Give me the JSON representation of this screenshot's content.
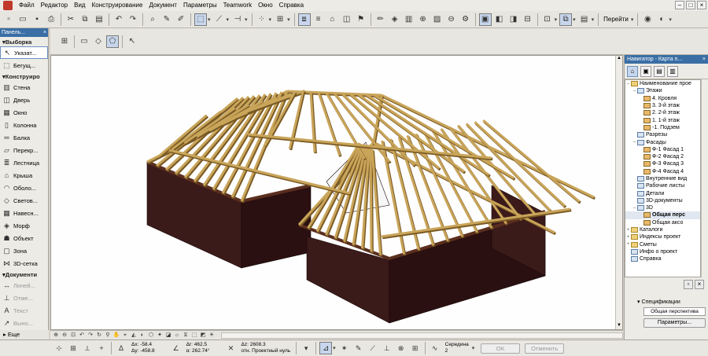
{
  "menu": {
    "items": [
      "Файл",
      "Редактор",
      "Вид",
      "Конструирование",
      "Документ",
      "Параметры",
      "Teamwork",
      "Окно",
      "Справка"
    ]
  },
  "toolbar": {
    "goto_label": "Перейти"
  },
  "toolbox": {
    "title": "Панель...",
    "items": [
      {
        "label": "Выборка",
        "type": "section"
      },
      {
        "label": "Указат...",
        "icon": "arrow-pointer-icon",
        "selected": true
      },
      {
        "label": "Бегущ...",
        "icon": "marquee-icon"
      },
      {
        "label": "Конструиро",
        "type": "section"
      },
      {
        "label": "Стена",
        "icon": "wall-icon"
      },
      {
        "label": "Дверь",
        "icon": "door-icon"
      },
      {
        "label": "Окно",
        "icon": "window-icon"
      },
      {
        "label": "Колонна",
        "icon": "column-icon"
      },
      {
        "label": "Балка",
        "icon": "beam-icon"
      },
      {
        "label": "Перекр...",
        "icon": "slab-icon"
      },
      {
        "label": "Лестница",
        "icon": "stair-icon"
      },
      {
        "label": "Крыша",
        "icon": "roof-icon"
      },
      {
        "label": "Оболо...",
        "icon": "shell-icon"
      },
      {
        "label": "Светов...",
        "icon": "skylight-icon"
      },
      {
        "label": "Навесн...",
        "icon": "curtain-wall-icon"
      },
      {
        "label": "Морф",
        "icon": "morph-icon"
      },
      {
        "label": "Объект",
        "icon": "object-icon"
      },
      {
        "label": "Зона",
        "icon": "zone-icon"
      },
      {
        "label": "3D-сетка",
        "icon": "mesh-icon"
      },
      {
        "label": "Документи",
        "type": "section"
      },
      {
        "label": "Линей...",
        "icon": "dimension-icon",
        "disabled": true
      },
      {
        "label": "Отме...",
        "icon": "level-dimension-icon",
        "disabled": true
      },
      {
        "label": "Текст",
        "icon": "text-icon",
        "disabled": true
      },
      {
        "label": "Выно...",
        "icon": "label-icon",
        "disabled": true
      }
    ],
    "more_label": "Еще"
  },
  "navigator": {
    "title": "Навигатор - Карта п...",
    "tree": [
      {
        "label": "Наименование прое",
        "level": 0,
        "icon": "folder",
        "exp": "–"
      },
      {
        "label": "Этажи",
        "level": 1,
        "icon": "view",
        "exp": "–"
      },
      {
        "label": "4. Кровля",
        "level": 2,
        "icon": "story"
      },
      {
        "label": "3. 3-й этаж",
        "level": 2,
        "icon": "story"
      },
      {
        "label": "2. 2-й этаж",
        "level": 2,
        "icon": "story"
      },
      {
        "label": "1. 1-й этаж",
        "level": 2,
        "icon": "story"
      },
      {
        "label": "-1. Подзем",
        "level": 2,
        "icon": "story"
      },
      {
        "label": "Разрезы",
        "level": 1,
        "icon": "view"
      },
      {
        "label": "Фасады",
        "level": 1,
        "icon": "view",
        "exp": "–"
      },
      {
        "label": "Ф-1 Фасад 1",
        "level": 2,
        "icon": "story"
      },
      {
        "label": "Ф-2 Фасад 2",
        "level": 2,
        "icon": "story"
      },
      {
        "label": "Ф-3 Фасад 3",
        "level": 2,
        "icon": "story"
      },
      {
        "label": "Ф-4 Фасад 4",
        "level": 2,
        "icon": "story"
      },
      {
        "label": "Внутренние вид",
        "level": 1,
        "icon": "view"
      },
      {
        "label": "Рабочие листы",
        "level": 1,
        "icon": "view"
      },
      {
        "label": "Детали",
        "level": 1,
        "icon": "view"
      },
      {
        "label": "3D-документы",
        "level": 1,
        "icon": "view"
      },
      {
        "label": "3D",
        "level": 1,
        "icon": "view",
        "exp": "–"
      },
      {
        "label": "Общая перс",
        "level": 2,
        "icon": "story",
        "bold": true,
        "highlight": true
      },
      {
        "label": "Общая аксо",
        "level": 2,
        "icon": "story"
      },
      {
        "label": "Каталоги",
        "level": 0,
        "icon": "folder",
        "exp": "+"
      },
      {
        "label": "Индексы проект",
        "level": 0,
        "icon": "folder",
        "exp": "+"
      },
      {
        "label": "Сметы",
        "level": 0,
        "icon": "folder",
        "exp": "+"
      },
      {
        "label": "Инфо о проект",
        "level": 0,
        "icon": "view"
      },
      {
        "label": "Справка",
        "level": 0,
        "icon": "view"
      }
    ],
    "spec_label": "Спецификации",
    "view_name": "Общая перспектива",
    "params_button": "Параметры..."
  },
  "statusbar": {
    "dx": "Δx: -58.4",
    "dy": "Δy: -458.8",
    "dr": "Δr: 462.5",
    "angle": "α: 262.74°",
    "dz": "Δz: 2608.3",
    "dz_ref": "отн. Проектный нуль",
    "snap_label": "Середина",
    "snap_value": "2",
    "ok_label": "OK",
    "cancel_label": "Отменить"
  },
  "colors": {
    "wall": "#3b1a1a",
    "wall_dark": "#2a1010",
    "rafter": "#c9a55a",
    "rafter_shadow": "#7a5a24",
    "wall_plate": "#5a2e1e",
    "accent": "#3a6ea5"
  }
}
